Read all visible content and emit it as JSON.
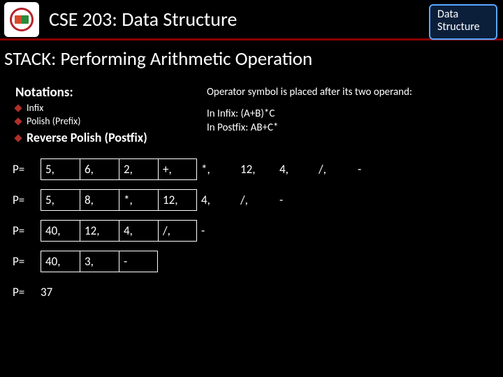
{
  "header": {
    "course_title": "CSE 203: Data Structure",
    "badge_line1": "Data",
    "badge_line2": "Structure"
  },
  "slide_title": "STACK: Performing Arithmetic Operation",
  "notations": {
    "heading": "Notations:",
    "items": [
      "Infix",
      "Polish (Prefix)"
    ],
    "reverse_label": "Reverse Polish (Postfix)"
  },
  "explanation": {
    "desc": "Operator symbol is placed after its two operand:",
    "ex_infix": "In Infix: (A+B)*C",
    "ex_postfix": "In Postfix: AB+C*"
  },
  "rows": [
    {
      "label": "P=",
      "boxed": [
        "5,",
        "6,",
        "2,",
        "+,"
      ],
      "rest": [
        "*,",
        "12,",
        "4,",
        "/,",
        "-"
      ]
    },
    {
      "label": "P=",
      "boxed": [
        "5,",
        "8,",
        "*,",
        "12,"
      ],
      "rest": [
        "4,",
        "/,",
        "-"
      ]
    },
    {
      "label": "P=",
      "boxed": [
        "40,",
        "12,",
        "4,",
        "/,"
      ],
      "rest": [
        "-"
      ]
    },
    {
      "label": "P=",
      "boxed": [
        "40,",
        "3,",
        "-"
      ],
      "rest": []
    }
  ],
  "result": {
    "label": "P=",
    "value": "37"
  }
}
